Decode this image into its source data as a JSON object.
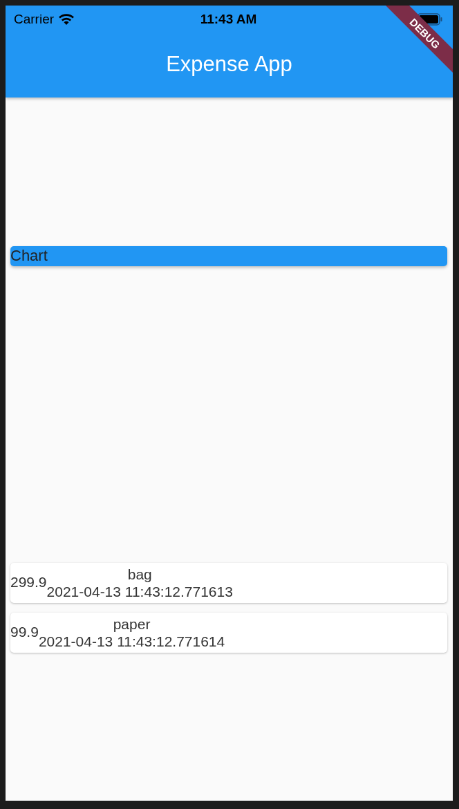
{
  "status_bar": {
    "carrier": "Carrier",
    "time": "11:43 AM"
  },
  "app_bar": {
    "title": "Expense App"
  },
  "debug_banner": "DEBUG",
  "chart": {
    "label": "Chart"
  },
  "transactions": [
    {
      "amount": "299.9",
      "title": "bag",
      "date": "2021-04-13 11:43:12.771613"
    },
    {
      "amount": "99.9",
      "title": "paper",
      "date": "2021-04-13 11:43:12.771614"
    }
  ]
}
